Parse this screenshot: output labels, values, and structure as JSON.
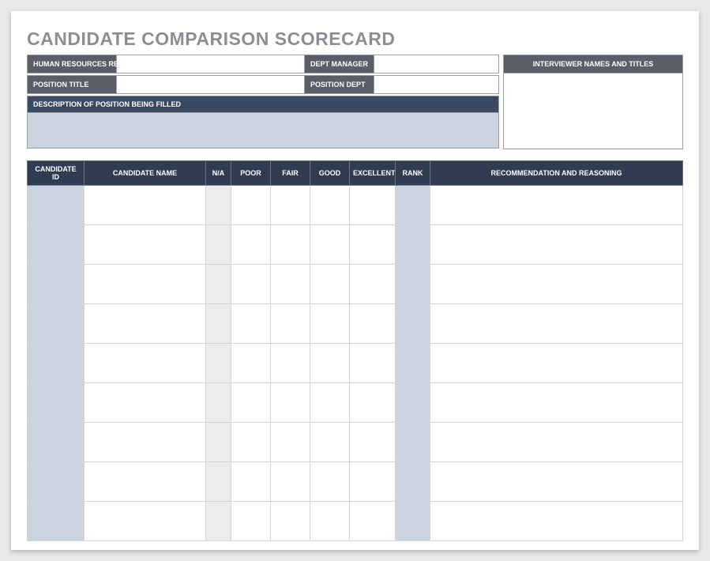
{
  "title": "CANDIDATE COMPARISON SCORECARD",
  "labels": {
    "hr_rep": "HUMAN RESOURCES REP",
    "dept_manager": "DEPT MANAGER",
    "position_title": "POSITION TITLE",
    "position_dept": "POSITION DEPT",
    "description": "DESCRIPTION OF POSITION BEING FILLED",
    "interviewer": "INTERVIEWER NAMES AND TITLES"
  },
  "values": {
    "hr_rep": "",
    "dept_manager": "",
    "position_title": "",
    "position_dept": "",
    "description": "",
    "interviewer": ""
  },
  "columns": {
    "candidate_id": "CANDIDATE ID",
    "candidate_name": "CANDIDATE NAME",
    "na": "N/A",
    "poor": "POOR",
    "fair": "FAIR",
    "good": "GOOD",
    "excellent": "EXCELLENT",
    "rank": "RANK",
    "recommendation": "RECOMMENDATION AND REASONING"
  },
  "rows": [
    {
      "id": "",
      "name": "",
      "na": "",
      "poor": "",
      "fair": "",
      "good": "",
      "excellent": "",
      "rank": "",
      "rec": ""
    },
    {
      "id": "",
      "name": "",
      "na": "",
      "poor": "",
      "fair": "",
      "good": "",
      "excellent": "",
      "rank": "",
      "rec": ""
    },
    {
      "id": "",
      "name": "",
      "na": "",
      "poor": "",
      "fair": "",
      "good": "",
      "excellent": "",
      "rank": "",
      "rec": ""
    },
    {
      "id": "",
      "name": "",
      "na": "",
      "poor": "",
      "fair": "",
      "good": "",
      "excellent": "",
      "rank": "",
      "rec": ""
    },
    {
      "id": "",
      "name": "",
      "na": "",
      "poor": "",
      "fair": "",
      "good": "",
      "excellent": "",
      "rank": "",
      "rec": ""
    },
    {
      "id": "",
      "name": "",
      "na": "",
      "poor": "",
      "fair": "",
      "good": "",
      "excellent": "",
      "rank": "",
      "rec": ""
    },
    {
      "id": "",
      "name": "",
      "na": "",
      "poor": "",
      "fair": "",
      "good": "",
      "excellent": "",
      "rank": "",
      "rec": ""
    },
    {
      "id": "",
      "name": "",
      "na": "",
      "poor": "",
      "fair": "",
      "good": "",
      "excellent": "",
      "rank": "",
      "rec": ""
    },
    {
      "id": "",
      "name": "",
      "na": "",
      "poor": "",
      "fair": "",
      "good": "",
      "excellent": "",
      "rank": "",
      "rec": ""
    }
  ]
}
